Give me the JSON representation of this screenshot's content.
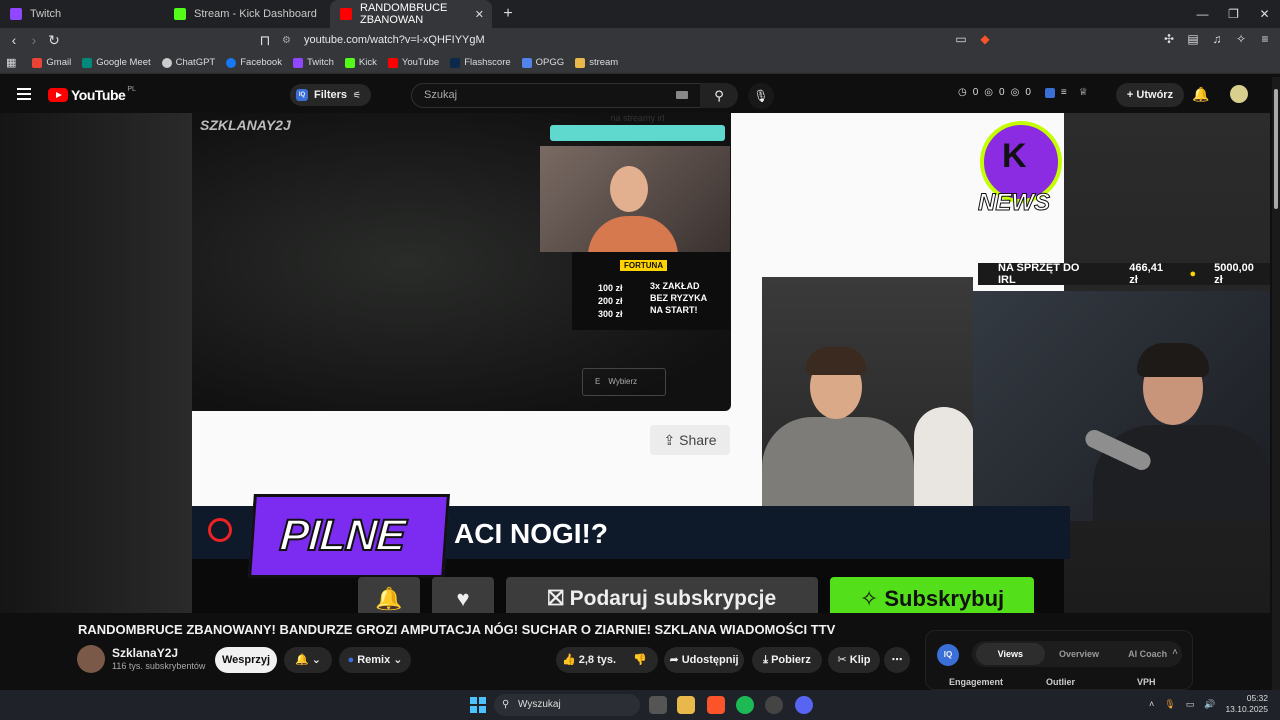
{
  "browser": {
    "tabs": [
      {
        "label": "Twitch",
        "color": "#9146ff"
      },
      {
        "label": "Stream - Kick Dashboard",
        "color": "#53fc18"
      },
      {
        "label": "RANDOMBRUCE ZBANOWAN",
        "color": "#ff0000"
      }
    ],
    "new_tab": "+",
    "url": "youtube.com/watch?v=l-xQHFIYYgM",
    "bookmarks": [
      {
        "label": "Gmail",
        "color": "#ea4335"
      },
      {
        "label": "Google Meet",
        "color": "#00897b"
      },
      {
        "label": "ChatGPT",
        "color": "#cccccc"
      },
      {
        "label": "Facebook",
        "color": "#1877f2"
      },
      {
        "label": "Twitch",
        "color": "#9146ff"
      },
      {
        "label": "Kick",
        "color": "#53fc18"
      },
      {
        "label": "YouTube",
        "color": "#ff0000"
      },
      {
        "label": "Flashscore",
        "color": "#0b2a4a"
      },
      {
        "label": "OPGG",
        "color": "#5383e8"
      },
      {
        "label": "stream",
        "color": "#e8b84a"
      }
    ]
  },
  "youtube": {
    "logo_text": "YouTube",
    "region": "PL",
    "filters_label": "Filters",
    "search_placeholder": "Szukaj",
    "stats": [
      "0",
      "0",
      "0"
    ],
    "create_label": "Utwórz"
  },
  "video_overlay": {
    "brand": "SZKLANAY2J",
    "stream_label": "na streamy irl",
    "fortuna_title": "FORTUNA",
    "fortuna_rows": [
      "100 zł",
      "200 zł",
      "300 zł"
    ],
    "fortuna_offer": [
      "3x ZAKŁAD",
      "BEZ RYZYKA",
      "NA START!"
    ],
    "wybierz": "Wybierz",
    "share_label": "Share",
    "k1_news": "NEWS",
    "irl_label": "NA SPRZĘT DO IRL",
    "irl_amount": "466,41 zł",
    "irl_goal": "5000,00 zł",
    "pilne": "PILNE",
    "headline": "ACI NOGI!?",
    "gift_label": "Podaruj subskrypcje",
    "subscribe_label": "Subskrybuj"
  },
  "video": {
    "title": "RANDOMBRUCE ZBANOWANY! BANDURZE GROZI AMPUTACJA NÓG! SUCHAR O ZIARNIE! SZKLANA WIADOMOŚCI TTV",
    "channel": "SzklanaY2J",
    "subscribers": "116 tys. subskrybentów",
    "support_label": "Wesprzyj",
    "remix_label": "Remix",
    "likes": "2,8 tys.",
    "share_label": "Udostępnij",
    "download_label": "Pobierz",
    "clip_label": "Klip"
  },
  "iq_panel": {
    "badge": "IQ",
    "tabs": [
      "Views",
      "Overview",
      "AI Coach"
    ],
    "active_tab": "Views",
    "columns": [
      "Engagement",
      "Outlier",
      "VPH"
    ]
  },
  "taskbar": {
    "search_label": "Wyszukaj",
    "time": "05:32",
    "date": "13.10.2025"
  }
}
